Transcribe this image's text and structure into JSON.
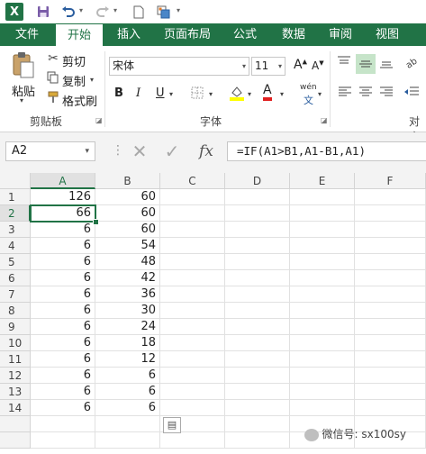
{
  "quick_access": {
    "app_icon": "excel-logo-icon",
    "app_letter": "X",
    "icons": [
      "save-icon",
      "undo-icon",
      "redo-icon",
      "new-document-icon",
      "customize-icon"
    ]
  },
  "tabs": [
    {
      "label": "文件",
      "active": false
    },
    {
      "label": "开始",
      "active": true
    },
    {
      "label": "插入",
      "active": false
    },
    {
      "label": "页面布局",
      "active": false
    },
    {
      "label": "公式",
      "active": false
    },
    {
      "label": "数据",
      "active": false
    },
    {
      "label": "审阅",
      "active": false
    },
    {
      "label": "视图",
      "active": false
    }
  ],
  "clipboard": {
    "paste": "粘贴",
    "cut": "剪切",
    "copy": "复制",
    "format_painter": "格式刷",
    "group_label": "剪贴板"
  },
  "font": {
    "name": "宋体",
    "size": "11",
    "grow": "A",
    "shrink": "A",
    "bold": "B",
    "italic": "I",
    "underline": "U",
    "font_color_letter": "A",
    "phonetic_top": "wén",
    "phonetic_bottom": "文",
    "group_label": "字体"
  },
  "alignment": {
    "group_label_partial": "对齐"
  },
  "formula_bar": {
    "name_box": "A2",
    "cancel_symbol": "✕",
    "enter_symbol": "✓",
    "fx": "fx",
    "formula": "=IF(A1>B1,A1-B1,A1)"
  },
  "sheet": {
    "columns": [
      "A",
      "B",
      "C",
      "D",
      "E",
      "F"
    ],
    "rows": [
      "1",
      "2",
      "3",
      "4",
      "5",
      "6",
      "7",
      "8",
      "9",
      "10",
      "11",
      "12",
      "13",
      "14"
    ],
    "A": [
      "126",
      "66",
      "6",
      "6",
      "6",
      "6",
      "6",
      "6",
      "6",
      "6",
      "6",
      "6",
      "6",
      "6"
    ],
    "B": [
      "60",
      "60",
      "60",
      "54",
      "48",
      "42",
      "36",
      "30",
      "24",
      "18",
      "12",
      "6",
      "6",
      "6"
    ],
    "active_cell": "A2"
  },
  "watermark": "微信号: sx100sy",
  "colors": {
    "accent": "#217346",
    "tab_text": "#ffffff",
    "header_bg": "#f3f3f3",
    "gridline": "#e1e1e1"
  }
}
